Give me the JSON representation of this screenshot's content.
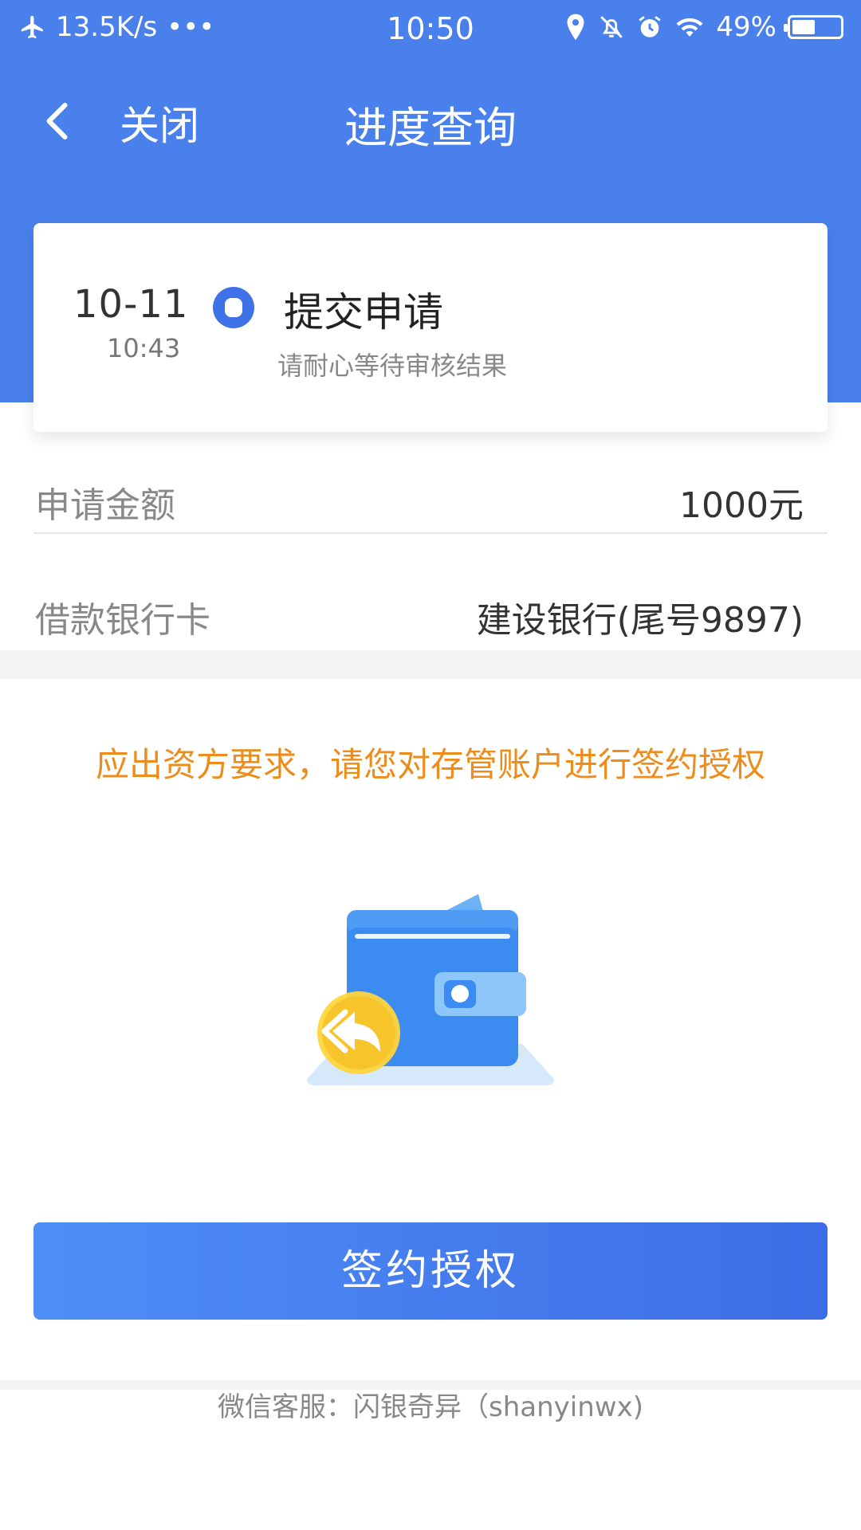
{
  "status_bar": {
    "speed": "13.5K/s",
    "more": "•••",
    "time": "10:50",
    "battery": "49%",
    "battery_level": 0.49
  },
  "nav": {
    "close_label": "关闭",
    "title": "进度查询"
  },
  "progress": {
    "date": "10-11",
    "time": "10:43",
    "step_title": "提交申请",
    "step_desc": "请耐心等待审核结果"
  },
  "details": {
    "amount_label": "申请金额",
    "amount_value": "1000元",
    "card_label": "借款银行卡",
    "card_value": "建设银行(尾号9897)"
  },
  "notice": "应出资方要求，请您对存管账户进行签约授权",
  "action": {
    "button_label": "签约授权"
  },
  "footer": "微信客服：闪银奇异（shanyinwx)",
  "colors": {
    "primary_blue": "#4a80ec",
    "notice_orange": "#ee8c1b"
  },
  "icons": {
    "airplane": "airplane-icon",
    "location": "location-icon",
    "mute": "bell-off-icon",
    "alarm": "alarm-icon",
    "wifi": "wifi-icon",
    "back": "chevron-left-icon",
    "wallet": "wallet-illustration"
  }
}
